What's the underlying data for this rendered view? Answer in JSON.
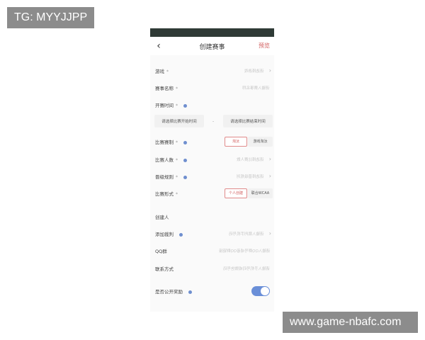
{
  "watermarks": {
    "top_left": "TG: MYYJJPP",
    "bottom_right": "www.game-nbafc.com"
  },
  "nav": {
    "back_icon": "chevron-left-icon",
    "title": "创建赛事",
    "preview": "预览"
  },
  "form": {
    "game": {
      "label": "游戏",
      "required": "*",
      "placeholder": "请选择游戏"
    },
    "name": {
      "label": "赛事名称",
      "required": "*",
      "placeholder": "请输入赛事名称"
    },
    "time": {
      "label": "开赛时间",
      "required": "*",
      "start": "请选择比赛开始时间",
      "separator": "-",
      "end": "请选择比赛结束时间"
    },
    "format": {
      "label": "比赛赛制",
      "required": "*",
      "option1": "淘汰",
      "option2": "游戏淘汰"
    },
    "count": {
      "label": "比赛人数",
      "required": "*",
      "placeholder": "请选择比赛人数"
    },
    "promotion": {
      "label": "晋级规则",
      "required": "*",
      "placeholder": "请选择晋级规则"
    },
    "mode": {
      "label": "比赛形式",
      "required": "*",
      "option1": "个人创建",
      "option2": "联合WCAA"
    },
    "creator": {
      "label": "创建人"
    },
    "referee": {
      "label": "添加裁判",
      "placeholder": "请输入裁判手机号码"
    },
    "qq": {
      "label": "QQ群",
      "placeholder": "请输入QQ群号或者QQ群链接"
    },
    "contact": {
      "label": "联系方式",
      "placeholder": "请输入手机号码或微信号码"
    },
    "public_reward": {
      "label": "是否公开奖励",
      "enabled": true
    }
  },
  "colors": {
    "status_bar": "#2f3a36",
    "accent_red": "#d05a5a",
    "toggle_blue": "#6a8fd8",
    "info_dot": "#6f8fcf"
  }
}
